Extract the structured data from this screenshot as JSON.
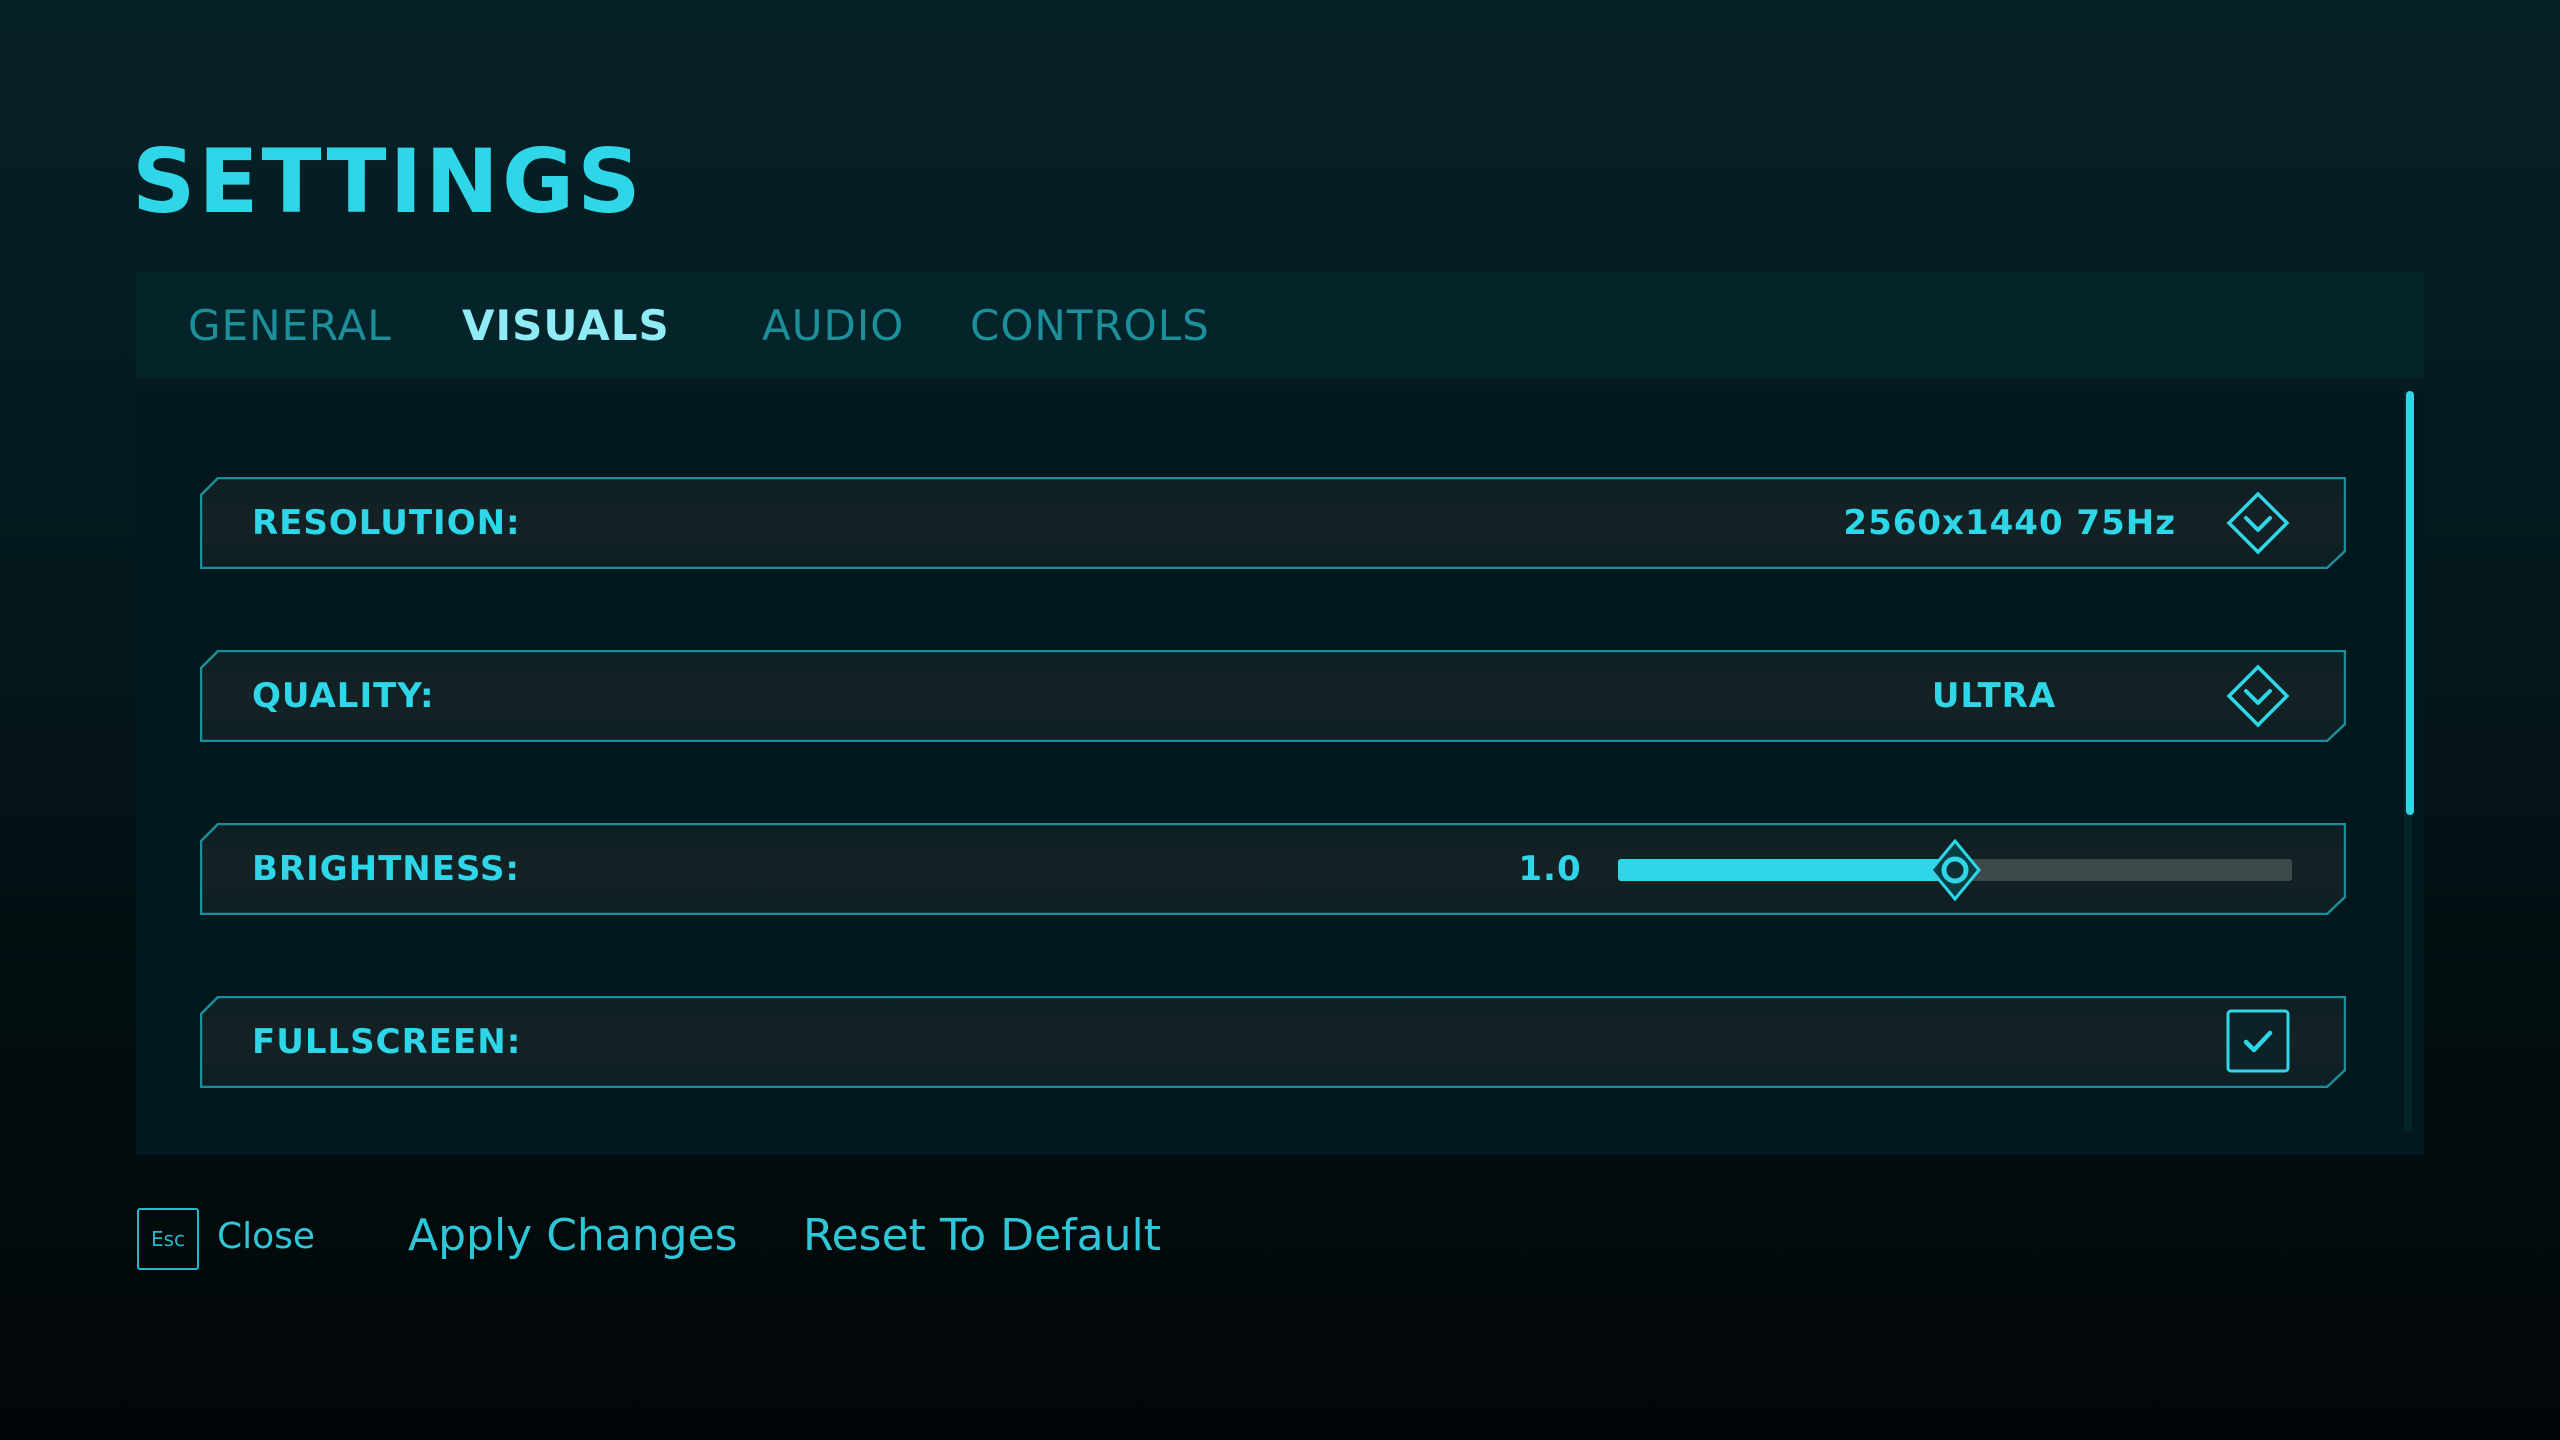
{
  "title": "SETTINGS",
  "tabs": [
    {
      "label": "GENERAL",
      "active": false
    },
    {
      "label": "VISUALS",
      "active": true
    },
    {
      "label": "AUDIO",
      "active": false
    },
    {
      "label": "CONTROLS",
      "active": false
    }
  ],
  "settings": {
    "resolution": {
      "label": "RESOLUTION:",
      "value": "2560x1440 75Hz",
      "icon": "chevron-down-diamond-icon"
    },
    "quality": {
      "label": "QUALITY:",
      "value": "ULTRA",
      "icon": "chevron-down-diamond-icon"
    },
    "brightness": {
      "label": "BRIGHTNESS:",
      "value": "1.0",
      "level": 0.5
    },
    "fullscreen": {
      "label": "FULLSCREEN:",
      "checked": true,
      "icon": "checkmark-icon"
    }
  },
  "footer": {
    "esc_key": "Esc",
    "close_label": "Close",
    "apply_label": "Apply Changes",
    "reset_label": "Reset To Default"
  },
  "colors": {
    "accent": "#2ed6e8",
    "accent_dim": "#1c8f9a",
    "active_tab": "#8fecf6",
    "row_border": "#1a8e9a",
    "track": "#3d4a4c"
  }
}
